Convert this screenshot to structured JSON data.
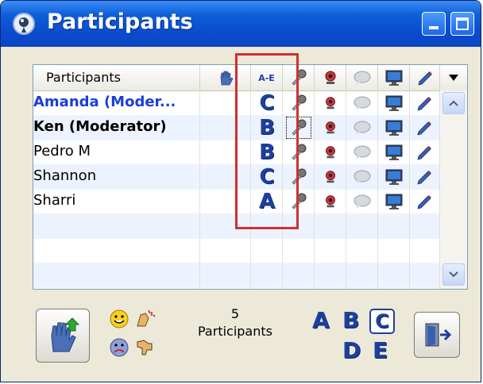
{
  "window": {
    "title": "Participants",
    "title_icon": "app-logo-icon",
    "controls": [
      "minimize-icon",
      "maximize-icon"
    ]
  },
  "grid": {
    "header": {
      "participants_label": "Participants",
      "columns": [
        "raise-hand-icon",
        "ae-sort-icon",
        "microphone-icon",
        "webcam-icon",
        "chat-bubble-icon",
        "monitor-icon",
        "pencil-icon",
        "dropdown-arrow-icon"
      ],
      "ae_label": "A-E"
    },
    "rows": [
      {
        "name": "Amanda (Moder...",
        "letter": "C",
        "style": "moderator-blue"
      },
      {
        "name": "Ken (Moderator)",
        "letter": "B",
        "style": "moderator"
      },
      {
        "name": "Pedro M",
        "letter": "B",
        "style": "normal"
      },
      {
        "name": "Shannon",
        "letter": "C",
        "style": "normal"
      },
      {
        "name": "Sharri",
        "letter": "A",
        "style": "normal"
      }
    ]
  },
  "footer": {
    "count_number": "5",
    "count_label": "Participants",
    "letters_top": [
      "A",
      "B",
      "C"
    ],
    "letters_bottom": [
      "D",
      "E"
    ],
    "selected_letter": "C"
  },
  "colors": {
    "titlebar": "#0a4bcd",
    "highlight": "#d0302f",
    "letter_blue": "#1e3f9e",
    "alt_row": "#edf3fe"
  }
}
